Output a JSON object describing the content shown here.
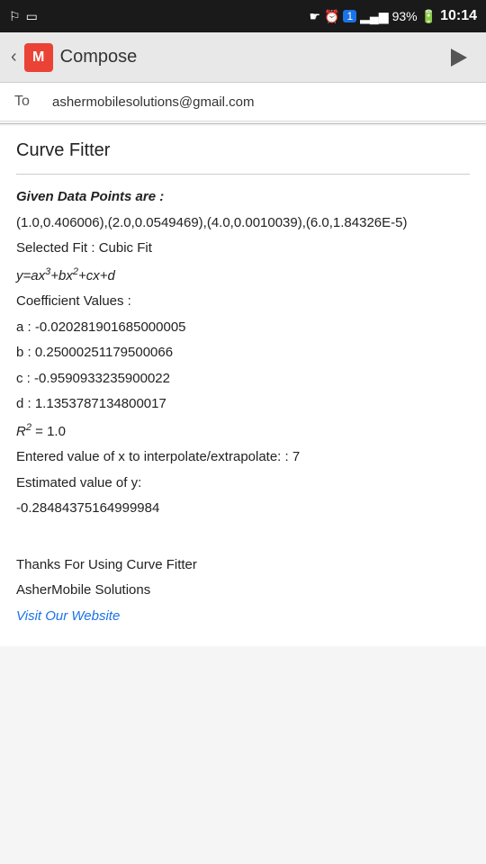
{
  "statusBar": {
    "leftIcons": [
      "usb-icon",
      "image-icon"
    ],
    "rightIcons": [
      "eye-icon",
      "alarm-icon",
      "notification-icon",
      "signal-icon",
      "battery-icon"
    ],
    "batteryPercent": "93%",
    "time": "10:14"
  },
  "appBar": {
    "title": "Compose",
    "sendLabel": "Send"
  },
  "toField": {
    "label": "To",
    "value": "ashermobilesolutions@gmail.com",
    "placeholder": "ashermobilesolutions@gmail.com"
  },
  "subject": "Curve Fitter",
  "emailBody": {
    "givenDataLabel": "Given Data Points are :",
    "dataPoints": "(1.0,0.406006),(2.0,0.0549469),(4.0,0.0010039),(6.0,1.84326E-5)",
    "selectedFit": "Selected Fit : Cubic Fit",
    "formula": "y=ax³+bx²+cx+d",
    "coefficientLabel": "Coefficient Values :",
    "aValue": "a : -0.020281901685000005",
    "bValue": "b : 0.25000251179500066",
    "cValue": "c : -0.9590933235900022",
    "dValue": "d : 1.1353787134800017",
    "r2": "R² = 1.0",
    "interpolateLabel": "Entered value of x to interpolate/extrapolate: : 7",
    "estimatedLabel": "Estimated value of y:",
    "estimatedValue": "-0.28484375164999984",
    "thanksLine1": "Thanks For Using Curve Fitter",
    "thanksLine2": "AsherMobile Solutions",
    "visitLink": "Visit Our Website"
  }
}
